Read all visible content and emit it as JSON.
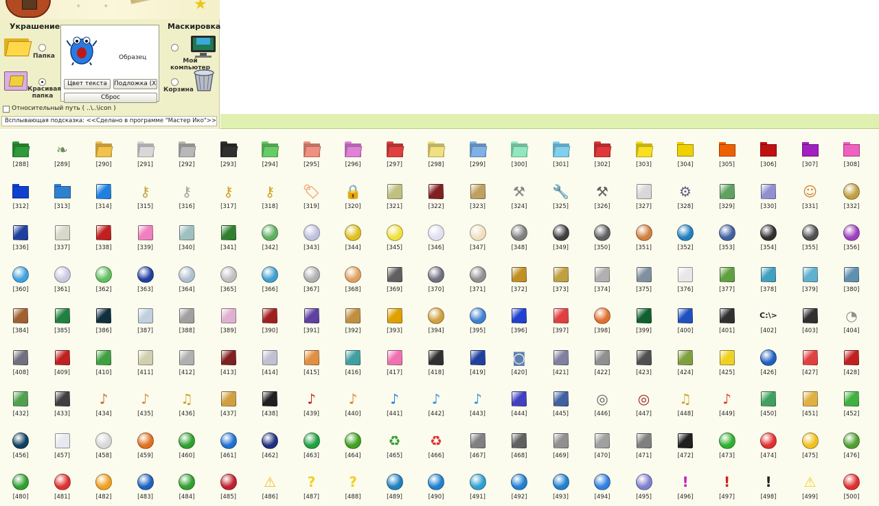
{
  "panel": {
    "decor_title": "Украшение",
    "mask_title": "Маскировка",
    "option_folder": "Папка",
    "option_pretty_folder": "Красивая папка",
    "option_my_computer": "Мой компьютер",
    "option_recycle_bin": "Корзина",
    "sample_label": "Образец",
    "btn_text_color": "Цвет текста",
    "btn_backing": "Подложка (XP)",
    "btn_reset": "Сброс",
    "relative_path_label": "Относительный путь ( ..\\..\\icon )",
    "tooltip_text": "Всплывающая подсказка: <<Сделано в программе \"Мастер Ико\">>"
  },
  "icons": {
    "rows": [
      [
        "[288]",
        "[289]",
        "[290]",
        "[291]",
        "[292]",
        "[293]",
        "[294]",
        "[295]",
        "[296]",
        "[297]",
        "[298]",
        "[299]",
        "[300]",
        "[301]",
        "[302]",
        "[303]",
        "[304]",
        "[305]",
        "[306]",
        "[307]",
        "[308]"
      ],
      [
        "[312]",
        "[313]",
        "[314]",
        "[315]",
        "[316]",
        "[317]",
        "[318]",
        "[319]",
        "[320]",
        "[321]",
        "[322]",
        "[323]",
        "[324]",
        "[325]",
        "[326]",
        "[327]",
        "[328]",
        "[329]",
        "[330]",
        "[331]",
        "[332]"
      ],
      [
        "[336]",
        "[337]",
        "[338]",
        "[339]",
        "[340]",
        "[341]",
        "[342]",
        "[343]",
        "[344]",
        "[345]",
        "[346]",
        "[347]",
        "[348]",
        "[349]",
        "[350]",
        "[351]",
        "[352]",
        "[353]",
        "[354]",
        "[355]",
        "[356]"
      ],
      [
        "[360]",
        "[361]",
        "[362]",
        "[363]",
        "[364]",
        "[365]",
        "[366]",
        "[367]",
        "[368]",
        "[369]",
        "[370]",
        "[371]",
        "[372]",
        "[373]",
        "[374]",
        "[375]",
        "[376]",
        "[377]",
        "[378]",
        "[379]",
        "[380]"
      ],
      [
        "[384]",
        "[385]",
        "[386]",
        "[387]",
        "[388]",
        "[389]",
        "[390]",
        "[391]",
        "[392]",
        "[393]",
        "[394]",
        "[395]",
        "[396]",
        "[397]",
        "[398]",
        "[399]",
        "[400]",
        "[401]",
        "[402]",
        "[403]",
        "[404]"
      ],
      [
        "[408]",
        "[409]",
        "[410]",
        "[411]",
        "[412]",
        "[413]",
        "[414]",
        "[415]",
        "[416]",
        "[417]",
        "[418]",
        "[419]",
        "[420]",
        "[421]",
        "[422]",
        "[423]",
        "[424]",
        "[425]",
        "[426]",
        "[427]",
        "[428]"
      ],
      [
        "[432]",
        "[433]",
        "[434]",
        "[435]",
        "[436]",
        "[437]",
        "[438]",
        "[439]",
        "[440]",
        "[441]",
        "[442]",
        "[443]",
        "[444]",
        "[445]",
        "[446]",
        "[447]",
        "[448]",
        "[449]",
        "[450]",
        "[451]",
        "[452]"
      ],
      [
        "[456]",
        "[457]",
        "[458]",
        "[459]",
        "[460]",
        "[461]",
        "[462]",
        "[463]",
        "[464]",
        "[465]",
        "[466]",
        "[467]",
        "[468]",
        "[469]",
        "[470]",
        "[471]",
        "[472]",
        "[473]",
        "[474]",
        "[475]",
        "[476]"
      ],
      [
        "[480]",
        "[481]",
        "[482]",
        "[483]",
        "[484]",
        "[485]",
        "[486]",
        "[487]",
        "[488]",
        "[489]",
        "[490]",
        "[491]",
        "[492]",
        "[493]",
        "[494]",
        "[495]",
        "[496]",
        "[497]",
        "[498]",
        "[499]",
        "[500]"
      ]
    ],
    "styles": [
      [
        [
          "folder",
          "#2e9a3a"
        ],
        [
          "glyph-leaf",
          "#6a8a5a"
        ],
        [
          "folder",
          "#f2c24a"
        ],
        [
          "folder",
          "#d8d8d8"
        ],
        [
          "folder",
          "#b8b8b8"
        ],
        [
          "folder",
          "#303030"
        ],
        [
          "folder",
          "#66cc66"
        ],
        [
          "folder",
          "#f09080"
        ],
        [
          "folder",
          "#e080d8"
        ],
        [
          "folder",
          "#e04040"
        ],
        [
          "folder",
          "#f0e080"
        ],
        [
          "folder",
          "#80b0e8"
        ],
        [
          "folder",
          "#90e8c0"
        ],
        [
          "folder",
          "#80d0f0"
        ],
        [
          "folder",
          "#e03838"
        ],
        [
          "folder",
          "#f8e020"
        ],
        [
          "box",
          "#f0d000"
        ],
        [
          "box",
          "#ee6000"
        ],
        [
          "box",
          "#c01010"
        ],
        [
          "box",
          "#a020c0"
        ],
        [
          "box",
          "#f060c0"
        ]
      ],
      [
        [
          "box",
          "#1040d0"
        ],
        [
          "box",
          "#3080d0"
        ],
        [
          "square",
          "#2080e0"
        ],
        [
          "glyph-key",
          "#c0a040"
        ],
        [
          "glyph-key",
          "#a0a0a0"
        ],
        [
          "glyph-key",
          "#d0a020"
        ],
        [
          "glyph-key",
          "#d0a020"
        ],
        [
          "glyph-tag",
          "#f0b080"
        ],
        [
          "glyph-lock",
          "#f0a020"
        ],
        [
          "square",
          "#c0c080"
        ],
        [
          "square",
          "#802020"
        ],
        [
          "square",
          "#c0a060"
        ],
        [
          "glyph-tools",
          "#808080"
        ],
        [
          "glyph-wrench",
          "#a0a0a0"
        ],
        [
          "glyph-tools",
          "#606060"
        ],
        [
          "square",
          "#d8d8d8"
        ],
        [
          "glyph-gear",
          "#606080"
        ],
        [
          "square",
          "#60a060"
        ],
        [
          "square",
          "#9090d0"
        ],
        [
          "glyph-person",
          "#d08030"
        ],
        [
          "disc",
          "#c0a040"
        ]
      ],
      [
        [
          "square",
          "#2040a0"
        ],
        [
          "square",
          "#d8d8c8"
        ],
        [
          "square",
          "#c02020"
        ],
        [
          "square",
          "#f080c0"
        ],
        [
          "square",
          "#a0c0c0"
        ],
        [
          "square",
          "#308030"
        ],
        [
          "disc",
          "#60b060"
        ],
        [
          "disc",
          "#c0c0e0"
        ],
        [
          "disc",
          "#e0c020"
        ],
        [
          "disc",
          "#f0e040"
        ],
        [
          "disc",
          "#e0e0f0"
        ],
        [
          "disc",
          "#f0e0c0"
        ],
        [
          "disc",
          "#808080"
        ],
        [
          "disc",
          "#404040"
        ],
        [
          "disc",
          "#606060"
        ],
        [
          "disc",
          "#d08040"
        ],
        [
          "disc",
          "#2080c0"
        ],
        [
          "disc",
          "#4060a0"
        ],
        [
          "disc",
          "#303030"
        ],
        [
          "disc",
          "#505050"
        ],
        [
          "disc",
          "#a040c0"
        ]
      ],
      [
        [
          "disc",
          "#40a0e0"
        ],
        [
          "disc",
          "#c8c8e0"
        ],
        [
          "disc",
          "#60c060"
        ],
        [
          "disc",
          "#2040a0"
        ],
        [
          "disc",
          "#b0c0d0"
        ],
        [
          "disc",
          "#c0c0c0"
        ],
        [
          "disc",
          "#40a0d0"
        ],
        [
          "disc",
          "#b0b0b0"
        ],
        [
          "disc",
          "#e0a060"
        ],
        [
          "square",
          "#606060"
        ],
        [
          "disc",
          "#707080"
        ],
        [
          "disc",
          "#909090"
        ],
        [
          "square",
          "#c09020"
        ],
        [
          "square",
          "#c0a040"
        ],
        [
          "square",
          "#b0b0b0"
        ],
        [
          "square",
          "#8090a0"
        ],
        [
          "square",
          "#e8e8e8"
        ],
        [
          "square",
          "#60a040"
        ],
        [
          "square",
          "#40a0c0"
        ],
        [
          "square",
          "#60b0d0"
        ],
        [
          "square",
          "#6090b0"
        ]
      ],
      [
        [
          "square",
          "#a06030"
        ],
        [
          "square",
          "#208040"
        ],
        [
          "square",
          "#103040"
        ],
        [
          "square",
          "#c0d0e0"
        ],
        [
          "square",
          "#a0a0a0"
        ],
        [
          "square",
          "#e0b0d0"
        ],
        [
          "square",
          "#a02020"
        ],
        [
          "square",
          "#6040a0"
        ],
        [
          "square",
          "#c09040"
        ],
        [
          "square",
          "#e0a000"
        ],
        [
          "disc",
          "#d0a040"
        ],
        [
          "disc",
          "#4080d0"
        ],
        [
          "square",
          "#2040d0"
        ],
        [
          "square",
          "#e04040"
        ],
        [
          "disc",
          "#e07030"
        ],
        [
          "square",
          "#106030"
        ],
        [
          "square",
          "#2050c0"
        ],
        [
          "square",
          "#303030"
        ],
        [
          "glyph-prompt",
          "#222222"
        ],
        [
          "square",
          "#303030"
        ],
        [
          "glyph-mouse",
          "#909090"
        ]
      ],
      [
        [
          "square",
          "#707080"
        ],
        [
          "square",
          "#c02020"
        ],
        [
          "square",
          "#40a040"
        ],
        [
          "square",
          "#d0d0b0"
        ],
        [
          "square",
          "#b0b0b0"
        ],
        [
          "square",
          "#802020"
        ],
        [
          "square",
          "#c0c0d0"
        ],
        [
          "square",
          "#e09040"
        ],
        [
          "square",
          "#40a0a0"
        ],
        [
          "square",
          "#f070b0"
        ],
        [
          "square",
          "#303030"
        ],
        [
          "square",
          "#2040a0"
        ],
        [
          "glyph-camera",
          "#6080b0"
        ],
        [
          "square",
          "#8080a0"
        ],
        [
          "square",
          "#909090"
        ],
        [
          "square",
          "#505050"
        ],
        [
          "square",
          "#80a040"
        ],
        [
          "square",
          "#f0d020"
        ],
        [
          "disc",
          "#2060c0"
        ],
        [
          "square",
          "#e04040"
        ],
        [
          "square",
          "#c02020"
        ]
      ],
      [
        [
          "square",
          "#50a050"
        ],
        [
          "square",
          "#404040"
        ],
        [
          "glyph-guitar",
          "#c07020"
        ],
        [
          "glyph-guitar",
          "#d09040"
        ],
        [
          "glyph-sax",
          "#d0a020"
        ],
        [
          "square",
          "#d0a040"
        ],
        [
          "square",
          "#202020"
        ],
        [
          "glyph-note",
          "#d02020"
        ],
        [
          "glyph-note",
          "#e08020"
        ],
        [
          "glyph-note",
          "#2080e0"
        ],
        [
          "glyph-note",
          "#3090e0"
        ],
        [
          "glyph-note",
          "#3090e0"
        ],
        [
          "square",
          "#4040c0"
        ],
        [
          "square",
          "#4060a0"
        ],
        [
          "glyph-drums",
          "#606060"
        ],
        [
          "glyph-drums",
          "#a02020"
        ],
        [
          "glyph-sax",
          "#d0a020"
        ],
        [
          "glyph-guitar",
          "#e04020"
        ],
        [
          "square",
          "#40a060"
        ],
        [
          "square",
          "#e0b040"
        ],
        [
          "square",
          "#40b040"
        ]
      ],
      [
        [
          "disc",
          "#104060"
        ],
        [
          "square",
          "#e8e8f0"
        ],
        [
          "disc",
          "#d8d8d8"
        ],
        [
          "disc",
          "#e07020"
        ],
        [
          "disc",
          "#30a030"
        ],
        [
          "disc",
          "#2070d0"
        ],
        [
          "disc",
          "#203080"
        ],
        [
          "disc",
          "#20a040"
        ],
        [
          "disc",
          "#40a020"
        ],
        [
          "glyph-recycle",
          "#30a030"
        ],
        [
          "glyph-recycle",
          "#e03030"
        ],
        [
          "square",
          "#808080"
        ],
        [
          "square",
          "#606060"
        ],
        [
          "square",
          "#909090"
        ],
        [
          "square",
          "#a0a0a0"
        ],
        [
          "square",
          "#808080"
        ],
        [
          "square",
          "#202020"
        ],
        [
          "disc",
          "#30b030"
        ],
        [
          "disc",
          "#e03030"
        ],
        [
          "disc",
          "#f0c020"
        ],
        [
          "disc",
          "#50a030"
        ]
      ],
      [
        [
          "disc",
          "#30a030"
        ],
        [
          "disc",
          "#e03030"
        ],
        [
          "disc",
          "#f0a020"
        ],
        [
          "disc",
          "#2060c0"
        ],
        [
          "disc",
          "#30a030"
        ],
        [
          "disc",
          "#c02030"
        ],
        [
          "glyph-warning",
          "#f0c020"
        ],
        [
          "glyph-question",
          "#f0d020"
        ],
        [
          "glyph-question",
          "#f0d020"
        ],
        [
          "disc",
          "#2080c0"
        ],
        [
          "disc",
          "#2080d0"
        ],
        [
          "disc",
          "#30a0d0"
        ],
        [
          "disc",
          "#2080d0"
        ],
        [
          "disc",
          "#2080d0"
        ],
        [
          "disc",
          "#3080e0"
        ],
        [
          "disc",
          "#8080d0"
        ],
        [
          "glyph-exclaim",
          "#c020c0"
        ],
        [
          "glyph-exclaim",
          "#d02020"
        ],
        [
          "glyph-exclaim",
          "#202020"
        ],
        [
          "glyph-warning",
          "#f0d020"
        ],
        [
          "disc",
          "#e03030"
        ]
      ]
    ]
  }
}
